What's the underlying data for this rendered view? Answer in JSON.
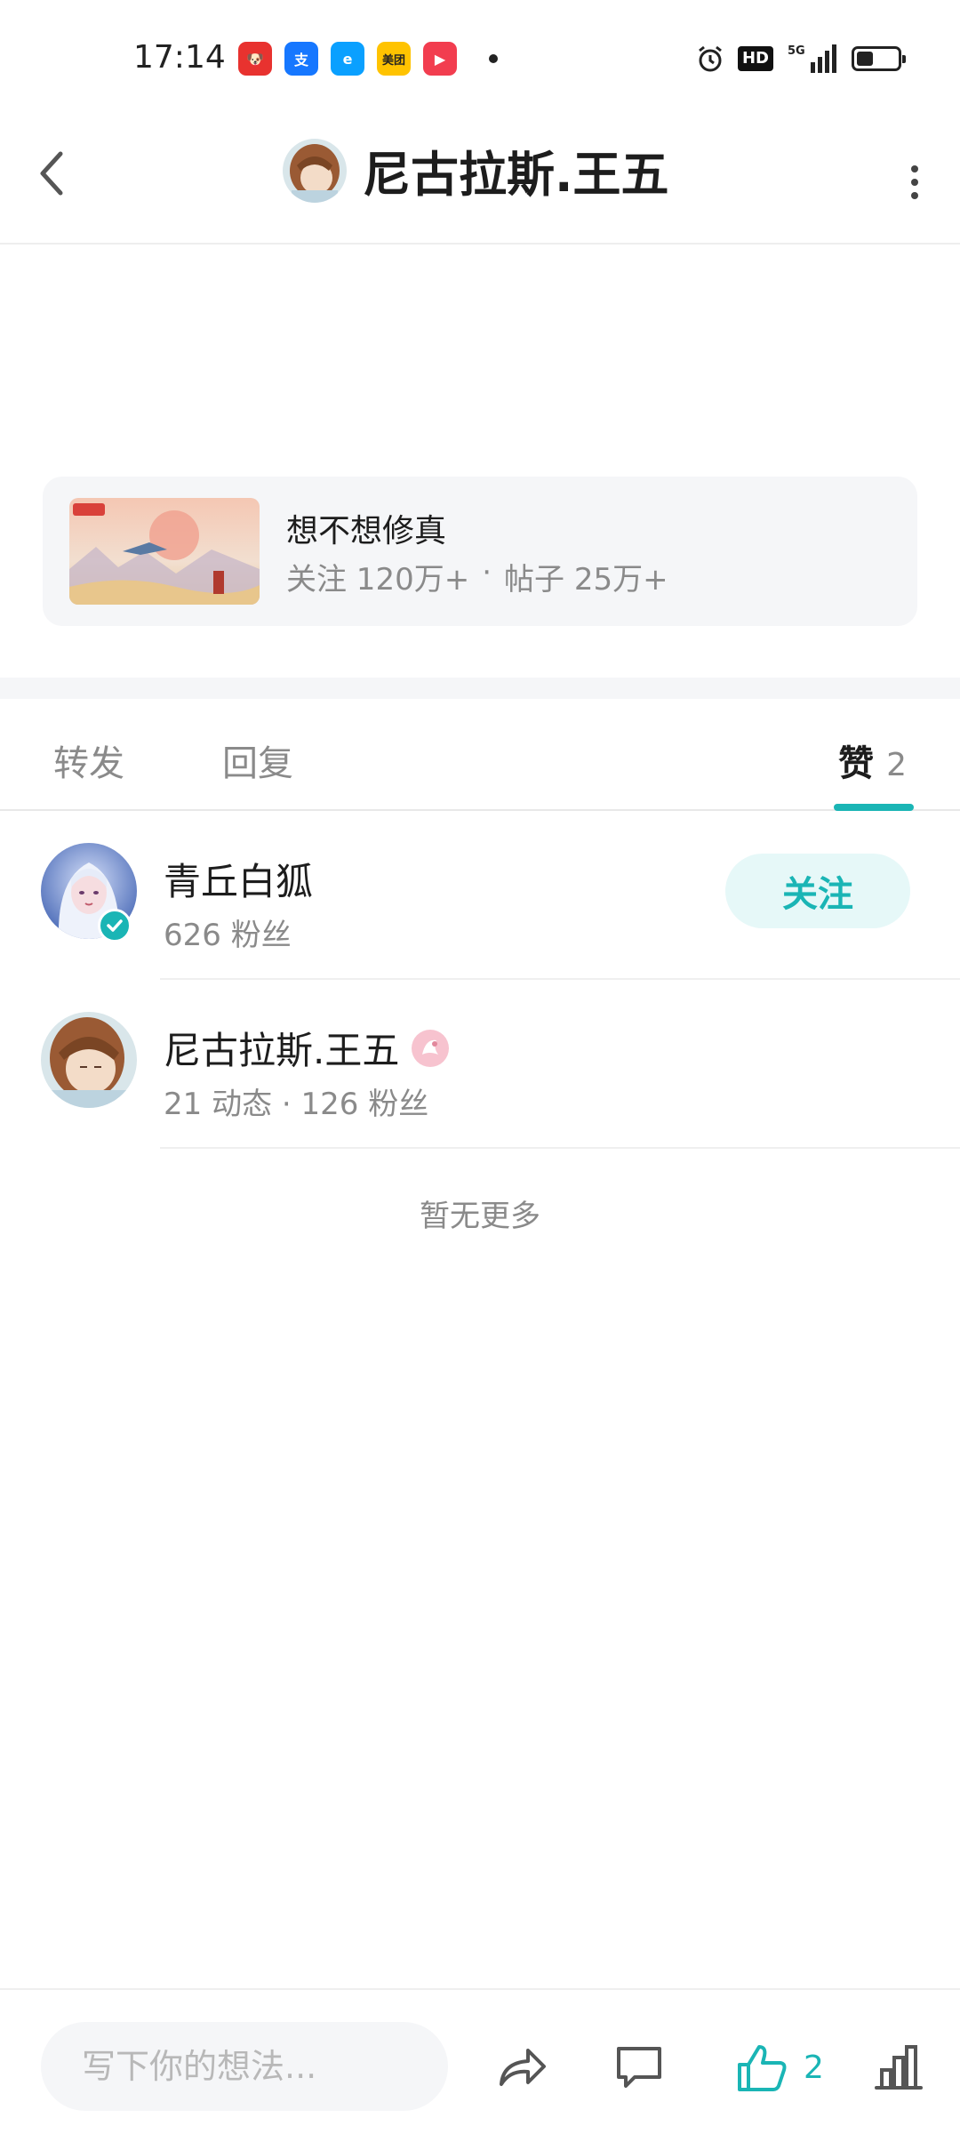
{
  "status_bar": {
    "time": "17:14",
    "apps": [
      {
        "name": "jd-app-icon",
        "color": "#e8322f",
        "glyph": "🐶"
      },
      {
        "name": "alipay-app-icon",
        "color": "#1677ff",
        "glyph": "支"
      },
      {
        "name": "eleme-app-icon",
        "color": "#0aa0ff",
        "glyph": "e"
      },
      {
        "name": "meituan-app-icon",
        "color": "#ffc300",
        "glyph": "美团"
      },
      {
        "name": "video-app-icon",
        "color": "#f23d4f",
        "glyph": "▶"
      }
    ],
    "hd_label": "HD",
    "signal_label": "5G"
  },
  "header": {
    "title": "尼古拉斯.王五"
  },
  "forum": {
    "name": "想不想修真",
    "follow_stat": "关注 120万+",
    "separator": "·",
    "post_stat": "帖子 25万+"
  },
  "tabs": {
    "forward": "转发",
    "reply": "回复",
    "like": "赞",
    "like_count": "2"
  },
  "likers": [
    {
      "name": "青丘白狐",
      "sub": "626 粉丝",
      "action": "关注"
    },
    {
      "name": "尼古拉斯.王五",
      "sub": "21 动态 · 126 粉丝"
    }
  ],
  "no_more_text": "暂无更多",
  "bottom_bar": {
    "placeholder": "写下你的想法...",
    "like_count": "2"
  },
  "colors": {
    "accent": "#1ab5b5",
    "accent_light": "#e6f8f8"
  }
}
